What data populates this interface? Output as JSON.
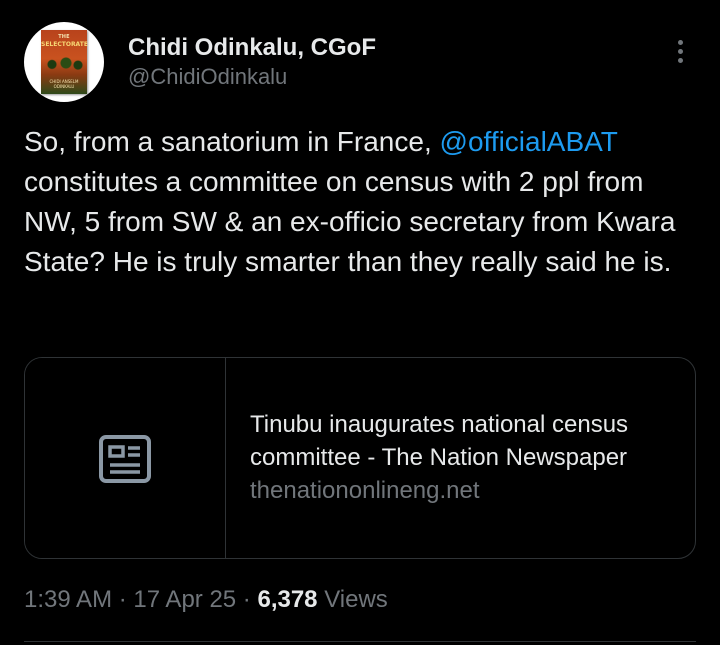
{
  "author": {
    "name": "Chidi Odinkalu, CGoF",
    "handle": "@ChidiOdinkalu",
    "avatar_book": {
      "title_line1": "THE",
      "title_line2": "SELECTORATE",
      "author_line": "CHIDI ANSELM ODINKALU"
    }
  },
  "tweet": {
    "text_part1": "So, from a sanatorium in France, ",
    "mention": "@officialABAT",
    "text_part2": " constitutes a committee on census with 2 ppl from NW, 5 from SW & an ex-officio secretary from Kwara State? He is truly smarter than they really said he is."
  },
  "link_card": {
    "title": "Tinubu inaugurates national census committee - The Nation Newspaper",
    "domain": "thenationonlineng.net",
    "thumbnail_icon": "article-icon"
  },
  "meta": {
    "time": "1:39 AM",
    "separator": " · ",
    "date": "17 Apr 25",
    "views_count": "6,378",
    "views_label": " Views"
  },
  "icons": {
    "more": "more-vertical-icon"
  },
  "colors": {
    "background": "#000000",
    "text": "#e7e9ea",
    "secondary": "#71767b",
    "accent": "#1d9bf0",
    "border": "#2f3336"
  }
}
